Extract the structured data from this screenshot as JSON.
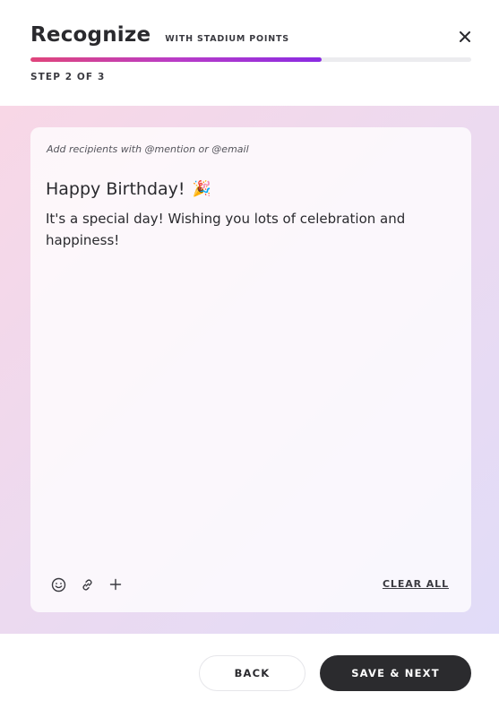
{
  "header": {
    "title": "Recognize",
    "subtitle": "WITH STADIUM POINTS",
    "step_label": "STEP 2 OF 3",
    "progress": 0.66,
    "close_icon": "close-icon"
  },
  "editor": {
    "recipients_placeholder": "Add recipients with @mention or @email",
    "message_title": "Happy Birthday!",
    "message_emoji": "🎉",
    "message_body": "It's a special day! Wishing you lots of celebration and happiness!",
    "toolbar_icons": [
      "emoji-icon",
      "link-icon",
      "plus-icon"
    ],
    "clear_all_label": "CLEAR ALL"
  },
  "footer": {
    "back_label": "BACK",
    "next_label": "SAVE & NEXT"
  },
  "colors": {
    "accent_start": "#e0457b",
    "accent_end": "#8a2be2",
    "primary_button": "#2b2b2e"
  }
}
